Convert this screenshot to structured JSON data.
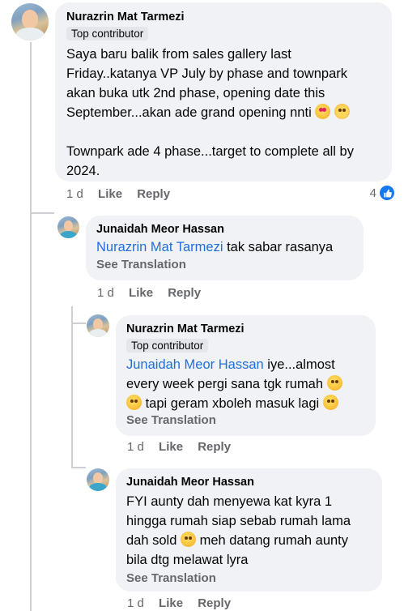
{
  "comments": [
    {
      "author": "Nurazrin Mat Tarmezi",
      "badge": "Top contributor",
      "text_line1": "Saya baru balik from sales gallery last",
      "text_line2": "Friday..katanya VP July by phase and townpark",
      "text_line3": "akan buka utk 2nd phase, opening date this",
      "text_line4": "September...akan ade grand opening nnti",
      "text_line5": "Townpark ade 4 phase...target to complete all by",
      "text_line6": "2024.",
      "time": "1 d",
      "like": "Like",
      "reply": "Reply",
      "reaction_count": "4"
    },
    {
      "author": "Junaidah Meor Hassan",
      "mention": "Nurazrin Mat Tarmezi",
      "text": " tak sabar rasanya",
      "see_translation": "See Translation",
      "time": "1 d",
      "like": "Like",
      "reply": "Reply"
    },
    {
      "author": "Nurazrin Mat Tarmezi",
      "badge": "Top contributor",
      "mention": "Junaidah Meor Hassan",
      "text_line1": " iye...almost",
      "text_line2": "every week pergi sana tgk rumah",
      "text_line3": " tapi geram xboleh masuk lagi",
      "see_translation": "See Translation",
      "time": "1 d",
      "like": "Like",
      "reply": "Reply"
    },
    {
      "author": "Junaidah Meor Hassan",
      "text_line1": "FYI aunty dah menyewa kat kyra 1",
      "text_line2": "hingga rumah siap sebab rumah lama",
      "text_line3": "dah sold",
      "text_line3b": " meh datang rumah aunty",
      "text_line4": "bila dtg melawat lyra",
      "see_translation": "See Translation",
      "time": "1 d",
      "like": "Like",
      "reply": "Reply"
    }
  ],
  "icons": {
    "reaction": "like-icon",
    "emojis": [
      "heart-eyes-emoji",
      "smiling-hearts-emoji",
      "laughing-emoji",
      "rolling-laughing-emoji",
      "grinning-sweat-emoji",
      "pensive-emoji"
    ]
  },
  "colors": {
    "bubble": "#f0f2f5",
    "mention": "#216fdb",
    "secondary_text": "#65676b",
    "like_blue": "#1877f2"
  }
}
